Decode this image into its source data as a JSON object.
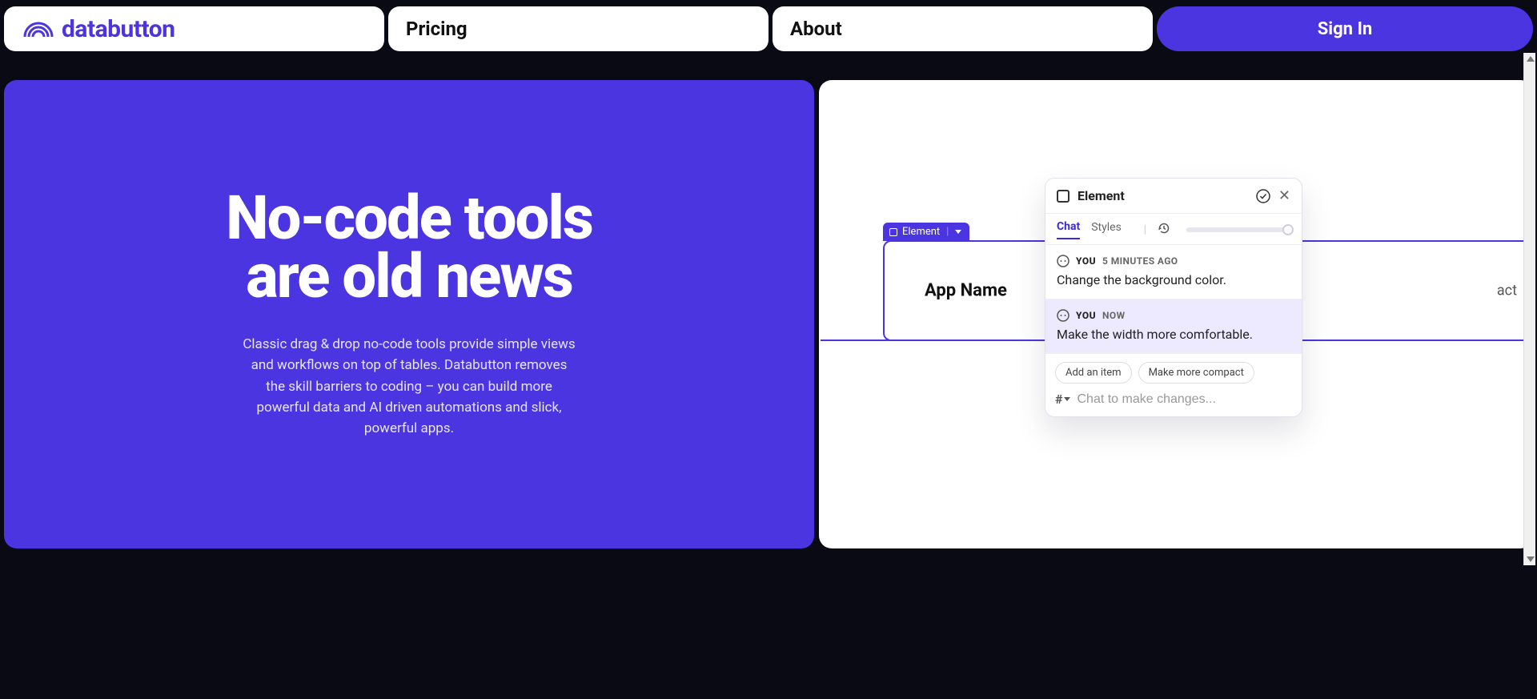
{
  "nav": {
    "brand": "databutton",
    "pricing": "Pricing",
    "about": "About",
    "signin": "Sign In"
  },
  "hero": {
    "title_line1": "No-code tools",
    "title_line2": "are old news",
    "body": "Classic drag & drop no-code tools provide simple views and workflows on top of tables. Databutton removes the skill barriers to coding – you can build more powerful data and AI driven automations and slick, powerful apps."
  },
  "preview": {
    "element_tab": "Element",
    "app_name": "App Name",
    "trailing_text": "act",
    "panel": {
      "title": "Element",
      "tabs": {
        "chat": "Chat",
        "styles": "Styles"
      },
      "messages": [
        {
          "who": "YOU",
          "when": "5 MINUTES AGO",
          "text": "Change the background color."
        },
        {
          "who": "YOU",
          "when": "NOW",
          "text": "Make the width more comfortable."
        }
      ],
      "chips": [
        "Add an item",
        "Make more compact"
      ],
      "composer_placeholder": "Chat to make changes..."
    }
  }
}
